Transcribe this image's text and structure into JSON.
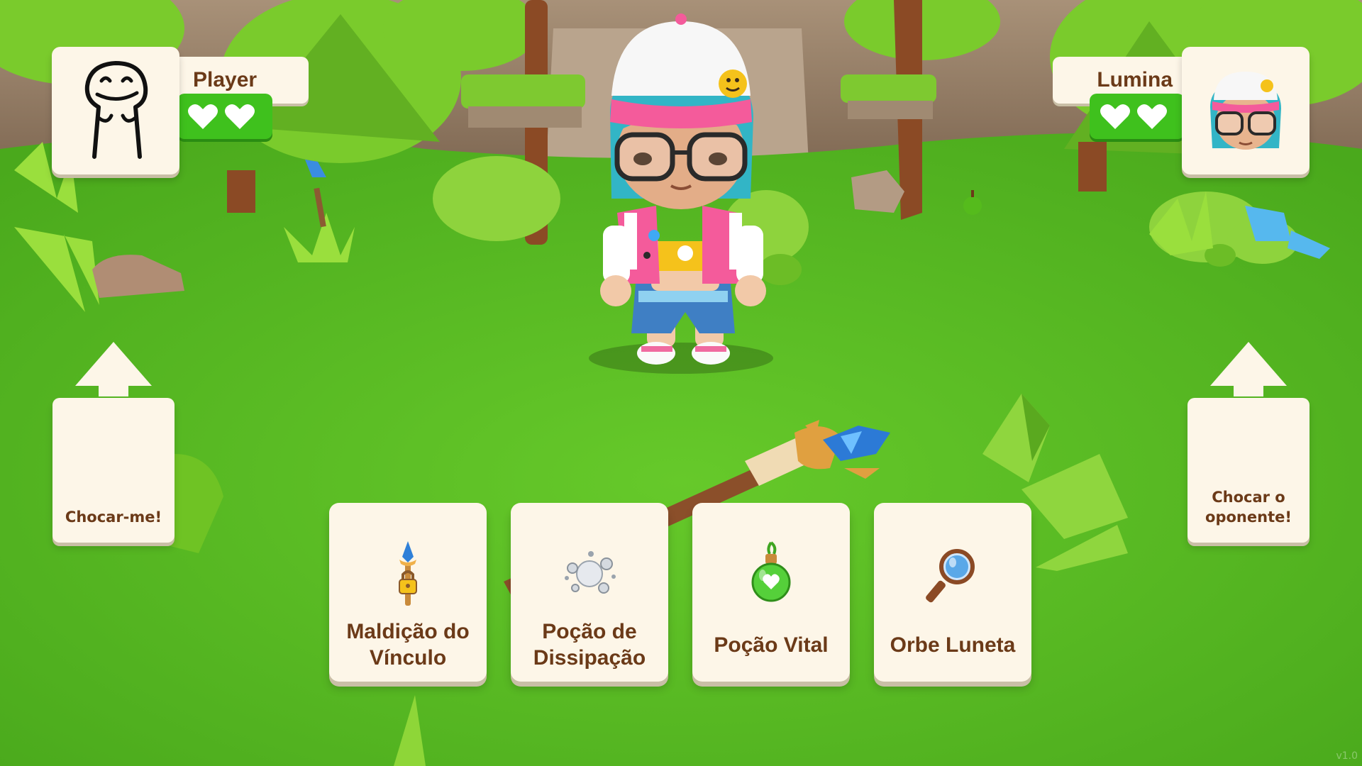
{
  "player": {
    "name": "Player",
    "hearts": 2,
    "avatar": "meme-face-drawing"
  },
  "opponent": {
    "name": "Lumina",
    "hearts": 2,
    "avatar": "lumina-character-face"
  },
  "actions": {
    "self": "Chocar-me!",
    "opponent_line1": "Chocar o",
    "opponent_line2": "oponente!"
  },
  "items": [
    {
      "label_line1": "Maldição do",
      "label_line2": "Vínculo",
      "icon": "binding-staff-lock-icon"
    },
    {
      "label_line1": "Poção de",
      "label_line2": "Dissipação",
      "icon": "dissipation-smoke-icon"
    },
    {
      "label_line1": "Poção Vital",
      "label_line2": "",
      "icon": "vital-potion-icon"
    },
    {
      "label_line1": "Orbe Luneta",
      "label_line2": "",
      "icon": "magnifier-orb-icon"
    }
  ],
  "version": "v1.0",
  "colors": {
    "card": "#fdf6e8",
    "text": "#6b3a18",
    "heart_bar": "#3fc11d",
    "grass": "#5cc226"
  }
}
